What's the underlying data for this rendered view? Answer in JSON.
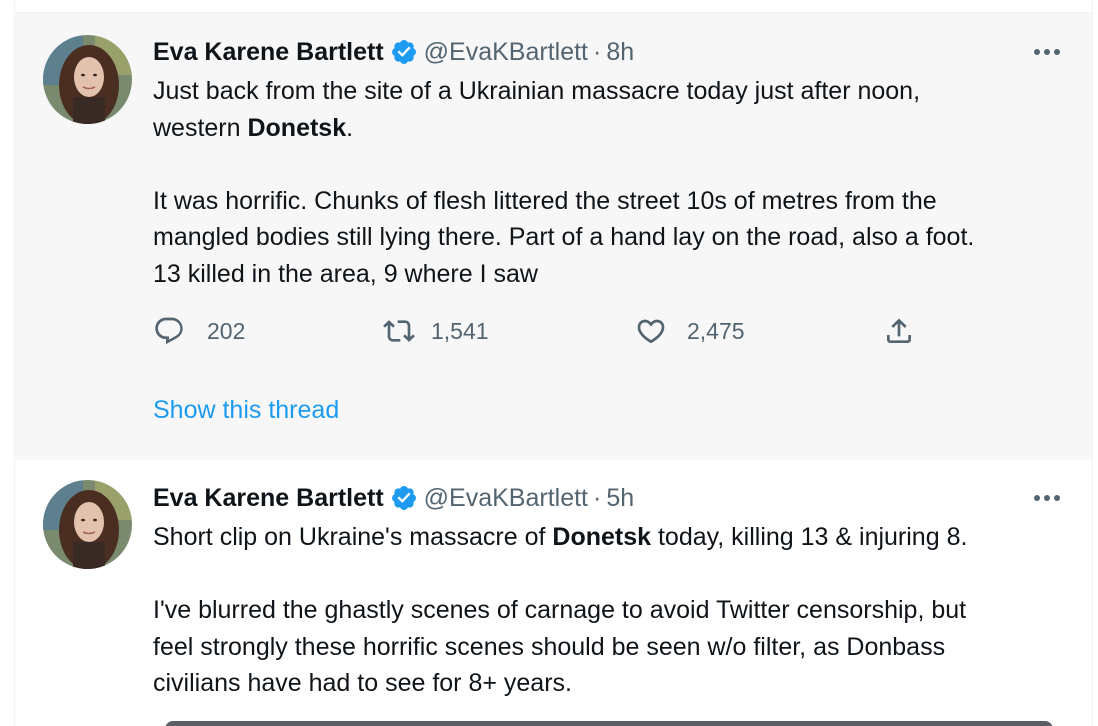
{
  "tweets": [
    {
      "name": "Eva Karene Bartlett",
      "handle": "@EvaKBartlett",
      "separator": "·",
      "time": "8h",
      "lines": [
        [
          "Just back from the site of a Ukrainian massacre today just after noon,"
        ],
        [
          "western ",
          {
            "bold": "Donetsk"
          },
          "."
        ],
        [],
        [
          "It was horrific. Chunks of flesh littered the street 10s of metres from the"
        ],
        [
          "mangled bodies still lying there. Part of a hand lay on the road, also a foot."
        ],
        [
          "13 killed in the area, 9 where I saw"
        ]
      ],
      "reply_count": "202",
      "retweet_count": "1,541",
      "like_count": "2,475",
      "show_thread": "Show this thread"
    },
    {
      "name": "Eva Karene Bartlett",
      "handle": "@EvaKBartlett",
      "separator": "·",
      "time": "5h",
      "lines": [
        [
          "Short clip on Ukraine's massacre of ",
          {
            "bold": "Donetsk"
          },
          " today, killing 13 & injuring 8."
        ],
        [],
        [
          "I've blurred the ghastly scenes of carnage to avoid Twitter censorship, but"
        ],
        [
          "feel strongly these horrific scenes should be seen w/o filter, as Donbass"
        ],
        [
          "civilians have had to see for 8+ years."
        ]
      ]
    }
  ],
  "icons": {
    "verified": "verified-badge-icon",
    "more": "more-options-icon",
    "reply": "reply-icon",
    "retweet": "retweet-icon",
    "like": "heart-icon",
    "share": "share-icon"
  },
  "colors": {
    "accent": "#1d9bf0",
    "secondary_text": "#536471",
    "highlight_bg": "#f7f7f7"
  }
}
